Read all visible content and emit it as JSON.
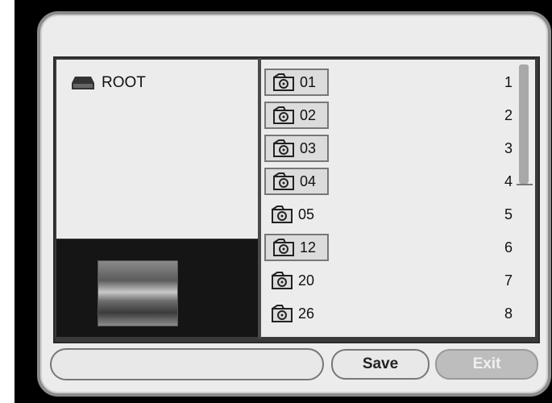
{
  "tree": {
    "root_label": "ROOT",
    "root_icon": "drive-icon"
  },
  "list": {
    "items": [
      {
        "label": "01",
        "index": "1",
        "boxed": true
      },
      {
        "label": "02",
        "index": "2",
        "boxed": true
      },
      {
        "label": "03",
        "index": "3",
        "boxed": true
      },
      {
        "label": "04",
        "index": "4",
        "boxed": true
      },
      {
        "label": "05",
        "index": "5",
        "boxed": false
      },
      {
        "label": "12",
        "index": "6",
        "boxed": true
      },
      {
        "label": "20",
        "index": "7",
        "boxed": false
      },
      {
        "label": "26",
        "index": "8",
        "boxed": false
      }
    ],
    "item_icon": "folder-icon"
  },
  "buttons": {
    "save_label": "Save",
    "exit_label": "Exit"
  },
  "status": {
    "text": ""
  }
}
